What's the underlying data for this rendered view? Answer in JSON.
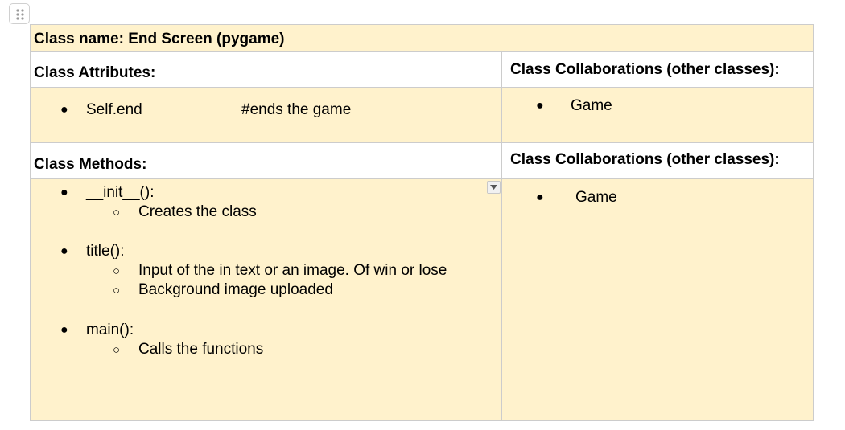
{
  "table": {
    "title": "Class name: End Screen (pygame)",
    "attributes_header": "Class Attributes:",
    "collab_header_1": "Class Collaborations (other classes):",
    "attributes": [
      {
        "name": "Self.end",
        "comment": "#ends the game"
      }
    ],
    "collab_1": [
      "Game"
    ],
    "methods_header": "Class Methods:",
    "collab_header_2": "Class Collaborations (other classes):",
    "methods": [
      {
        "name": "__init__():",
        "details": [
          "Creates the class"
        ]
      },
      {
        "name": "title():",
        "details": [
          "Input of the in text or an image. Of win or lose",
          "Background image uploaded"
        ]
      },
      {
        "name": "main():",
        "details": [
          "Calls the functions"
        ]
      }
    ],
    "collab_2": [
      "Game"
    ]
  },
  "icons": {
    "drag": "drag-handle-icon",
    "dropdown": "chevron-down-icon"
  },
  "colors": {
    "cell_fill": "#fff2cc",
    "border": "#cccccc"
  }
}
